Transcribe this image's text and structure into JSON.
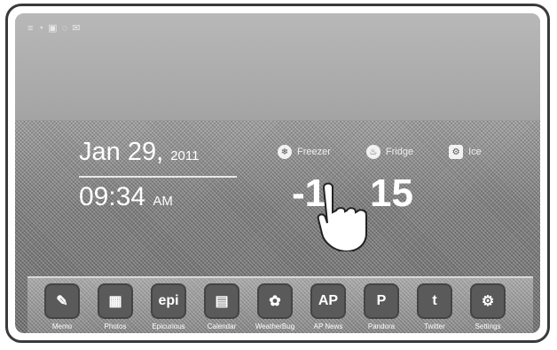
{
  "status_text": "≡ ◔ ▣ ◌ ✉",
  "clock": {
    "date_main": "Jan 29,",
    "date_year": "2011",
    "time_main": "09:34",
    "time_ampm": "AM"
  },
  "panels": [
    {
      "icon": "❄",
      "label": "Freezer"
    },
    {
      "icon": "♨",
      "label": "Fridge"
    },
    {
      "icon": "⚙",
      "label": "Ice"
    }
  ],
  "temps": {
    "freezer": "-1",
    "fridge": "15"
  },
  "dock": [
    {
      "label": "Memo",
      "glyph": "✎"
    },
    {
      "label": "Photos",
      "glyph": "▦"
    },
    {
      "label": "Epicurious",
      "glyph": "epi"
    },
    {
      "label": "Calendar",
      "glyph": "▤"
    },
    {
      "label": "WeatherBug",
      "glyph": "✿"
    },
    {
      "label": "AP News",
      "glyph": "AP"
    },
    {
      "label": "Pandora",
      "glyph": "P"
    },
    {
      "label": "Twitter",
      "glyph": "t"
    },
    {
      "label": "Settings",
      "glyph": "⚙"
    }
  ]
}
